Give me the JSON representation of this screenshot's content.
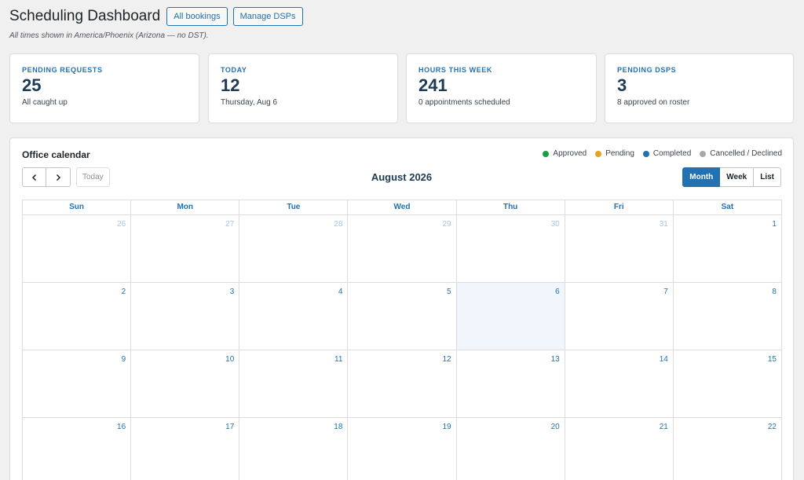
{
  "header": {
    "title": "Scheduling Dashboard",
    "all_bookings_label": "All bookings",
    "manage_dsps_label": "Manage DSPs",
    "timezone_note": "All times shown in America/Phoenix (Arizona — no DST)."
  },
  "stats": [
    {
      "label": "PENDING REQUESTS",
      "value": "25",
      "sub": "All caught up"
    },
    {
      "label": "TODAY",
      "value": "12",
      "sub": "Thursday, Aug 6"
    },
    {
      "label": "HOURS THIS WEEK",
      "value": "241",
      "sub": "0 appointments scheduled"
    },
    {
      "label": "PENDING DSPS",
      "value": "3",
      "sub": "8 approved on roster"
    }
  ],
  "calendar": {
    "title": "Office calendar",
    "month_label": "August 2026",
    "today_label": "Today",
    "legend": [
      {
        "label": "Approved",
        "color": "#1a9f3f"
      },
      {
        "label": "Pending",
        "color": "#e6a21c"
      },
      {
        "label": "Completed",
        "color": "#2271b1"
      },
      {
        "label": "Cancelled / Declined",
        "color": "#a7aaad"
      }
    ],
    "views": [
      {
        "label": "Month",
        "active": true
      },
      {
        "label": "Week",
        "active": false
      },
      {
        "label": "List",
        "active": false
      }
    ],
    "weekdays": [
      "Sun",
      "Mon",
      "Tue",
      "Wed",
      "Thu",
      "Fri",
      "Sat"
    ],
    "weeks": [
      [
        {
          "d": "26",
          "other": true
        },
        {
          "d": "27",
          "other": true
        },
        {
          "d": "28",
          "other": true
        },
        {
          "d": "29",
          "other": true
        },
        {
          "d": "30",
          "other": true
        },
        {
          "d": "31",
          "other": true
        },
        {
          "d": "1"
        }
      ],
      [
        {
          "d": "2"
        },
        {
          "d": "3"
        },
        {
          "d": "4"
        },
        {
          "d": "5"
        },
        {
          "d": "6",
          "today": true
        },
        {
          "d": "7"
        },
        {
          "d": "8"
        }
      ],
      [
        {
          "d": "9"
        },
        {
          "d": "10"
        },
        {
          "d": "11"
        },
        {
          "d": "12"
        },
        {
          "d": "13"
        },
        {
          "d": "14"
        },
        {
          "d": "15"
        }
      ],
      [
        {
          "d": "16"
        },
        {
          "d": "17"
        },
        {
          "d": "18"
        },
        {
          "d": "19"
        },
        {
          "d": "20"
        },
        {
          "d": "21"
        },
        {
          "d": "22"
        }
      ]
    ]
  }
}
